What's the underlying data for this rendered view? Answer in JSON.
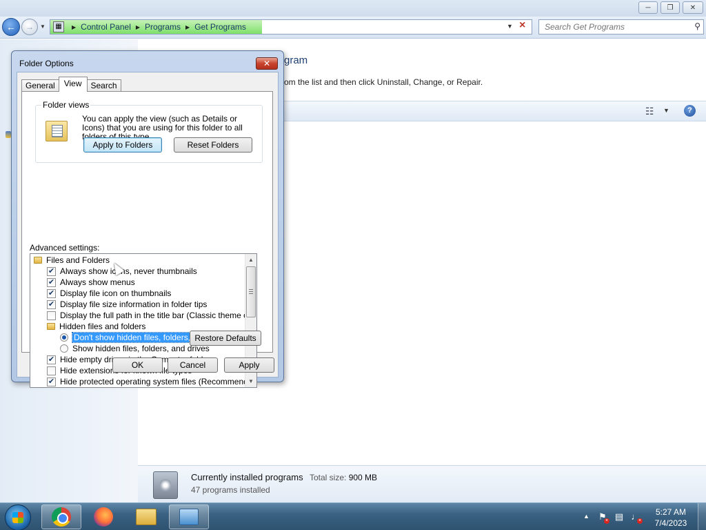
{
  "explorer": {
    "breadcrumb": [
      "Control Panel",
      "Programs",
      "Get Programs"
    ],
    "search_placeholder": "Search Get Programs",
    "main_title": "gram",
    "main_desc": "om the list and then click Uninstall, Change, or Repair.",
    "load_progress": 0.44,
    "details": {
      "title": "Currently installed programs",
      "size_label": "Total size:",
      "size_value": "900 MB",
      "count": "47 programs installed"
    }
  },
  "dialog": {
    "title": "Folder Options",
    "tabs": [
      {
        "label": "General",
        "active": false
      },
      {
        "label": "View",
        "active": true
      },
      {
        "label": "Search",
        "active": false
      }
    ],
    "folder_views": {
      "legend": "Folder views",
      "text": "You can apply the view (such as Details or Icons) that you are using for this folder to all folders of this type.",
      "apply_label": "Apply to Folders",
      "reset_label": "Reset Folders"
    },
    "advanced_label": "Advanced settings:",
    "tree": [
      {
        "type": "folder",
        "label": "Files and Folders",
        "indent": 0
      },
      {
        "type": "check",
        "label": "Always show icons, never thumbnails",
        "checked": true,
        "indent": 1
      },
      {
        "type": "check",
        "label": "Always show menus",
        "checked": true,
        "indent": 1
      },
      {
        "type": "check",
        "label": "Display file icon on thumbnails",
        "checked": true,
        "indent": 1
      },
      {
        "type": "check",
        "label": "Display file size information in folder tips",
        "checked": true,
        "indent": 1
      },
      {
        "type": "check",
        "label": "Display the full path in the title bar (Classic theme only)",
        "checked": false,
        "indent": 1
      },
      {
        "type": "folder",
        "label": "Hidden files and folders",
        "indent": 1
      },
      {
        "type": "radio",
        "label": "Don't show hidden files, folders, or drives",
        "checked": true,
        "selected": true,
        "indent": 2
      },
      {
        "type": "radio",
        "label": "Show hidden files, folders, and drives",
        "checked": false,
        "indent": 2
      },
      {
        "type": "check",
        "label": "Hide empty drives in the Computer folder",
        "checked": true,
        "indent": 1
      },
      {
        "type": "check",
        "label": "Hide extensions for known file types",
        "checked": false,
        "indent": 1
      },
      {
        "type": "check",
        "label": "Hide protected operating system files (Recommended)",
        "checked": true,
        "indent": 1
      }
    ],
    "restore_label": "Restore Defaults",
    "ok_label": "OK",
    "cancel_label": "Cancel",
    "apply_label": "Apply"
  },
  "taskbar": {
    "time": "5:27 AM",
    "date": "7/4/2023"
  },
  "icons": {
    "back": "back-arrow-icon",
    "forward": "forward-arrow-icon",
    "search": "search-icon",
    "help": "help-icon",
    "close": "close-icon"
  },
  "colors": {
    "selection": "#3399ff",
    "close_button": "#c8432d",
    "title_text": "#1e3f72"
  }
}
